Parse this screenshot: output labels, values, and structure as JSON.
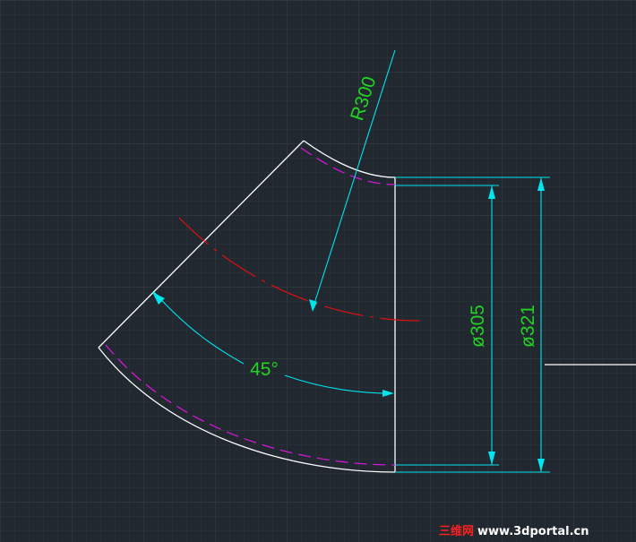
{
  "drawing": {
    "radius_label": "R300",
    "angle_label": "45°",
    "inner_diameter_label": "ø305",
    "outer_diameter_label": "ø321"
  },
  "watermark": {
    "cn": "三维网",
    "url": "www.3dportal.cn"
  },
  "colors": {
    "background": "#212830",
    "grid_minor": "#2b333c",
    "grid_major": "#39424d",
    "outline": "#ffffff",
    "dimension": "#00e5ee",
    "dim_text": "#22d422",
    "centerline": "#e01010",
    "hidden_line": "#d218d2",
    "watermark_cn": "#ff2020",
    "watermark_url": "#ffffff"
  }
}
